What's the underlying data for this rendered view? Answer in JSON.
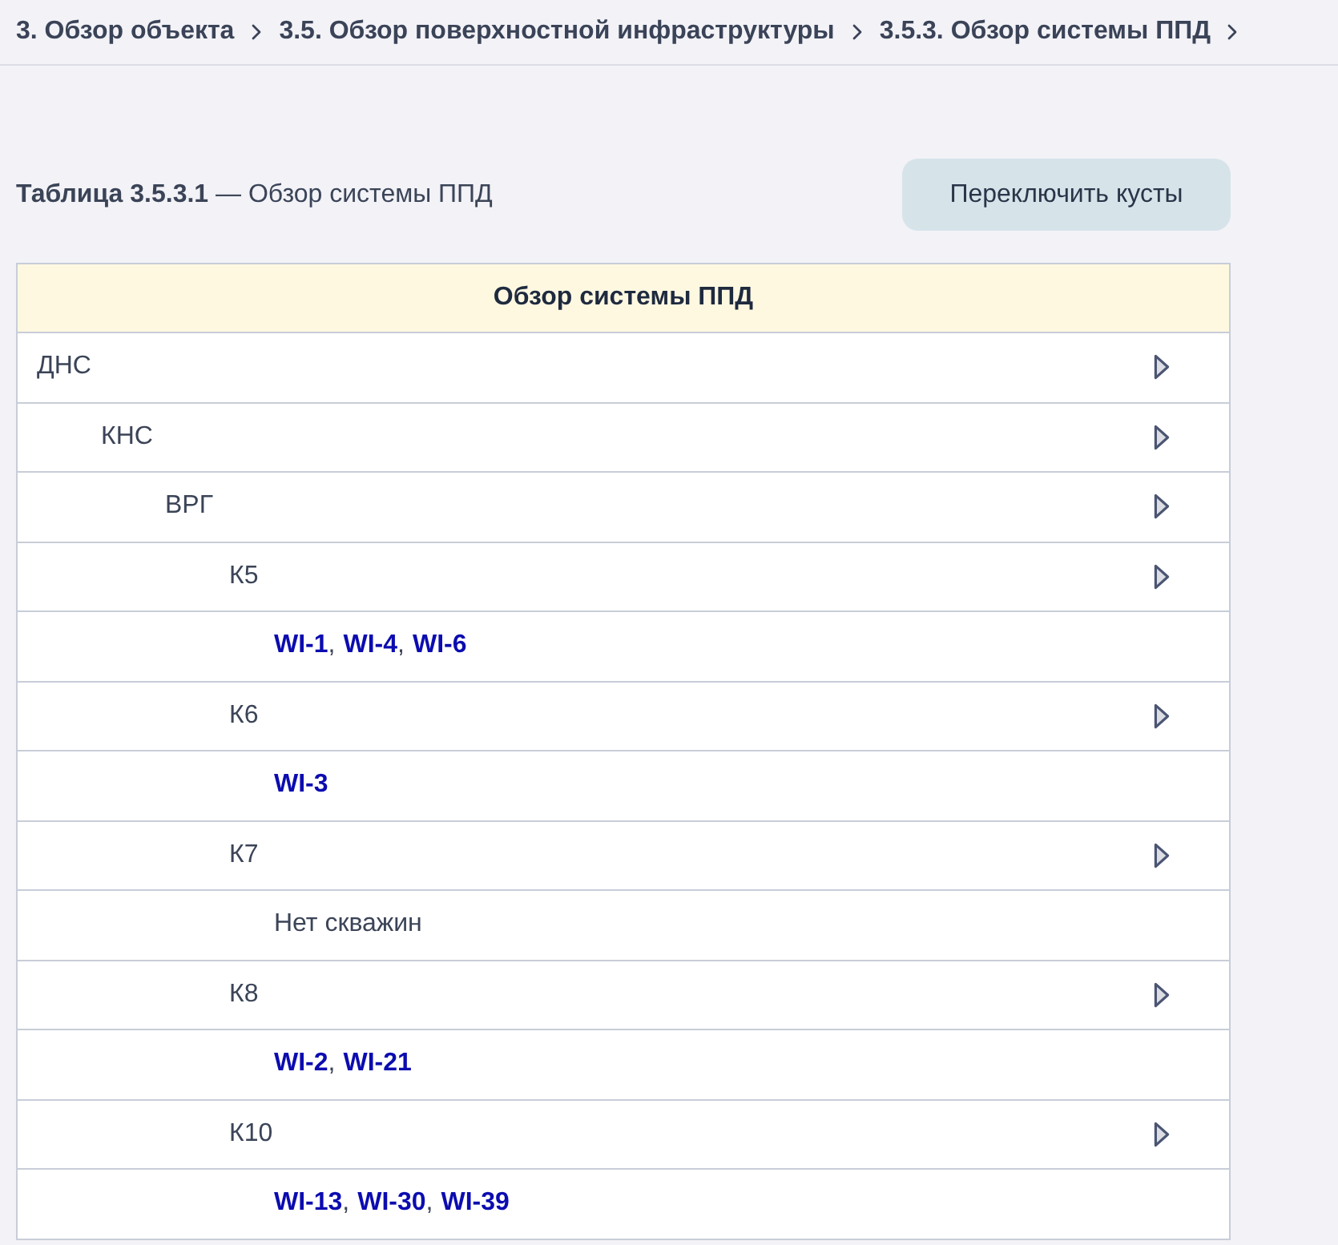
{
  "breadcrumbs": [
    "3. Обзор объекта",
    "3.5. Обзор поверхностной инфраструктуры",
    "3.5.3. Обзор системы ППД"
  ],
  "caption": "**Таблица 3.5.3.1** — Обзор системы ППД",
  "toggle_button": {
    "label": "Переключить кусты"
  },
  "table": {
    "header": "Обзор системы ППД",
    "list_separator": ",",
    "rows": [
      {
        "kind": "node",
        "label": "ДНС",
        "children": [
          {
            "kind": "node",
            "label": "КНС",
            "children": [
              {
                "kind": "node",
                "label": "ВРГ",
                "children": [
                  {
                    "kind": "node",
                    "label": "К5",
                    "children": [
                      {
                        "kind": "wells",
                        "wells": [
                          "WI-1",
                          "WI-4",
                          "WI-6"
                        ]
                      }
                    ]
                  },
                  {
                    "kind": "node",
                    "label": "К6",
                    "children": [
                      {
                        "kind": "wells",
                        "wells": [
                          "WI-3"
                        ]
                      }
                    ]
                  },
                  {
                    "kind": "node",
                    "label": "К7",
                    "children": [
                      {
                        "kind": "empty",
                        "label": "Нет скважин"
                      }
                    ]
                  },
                  {
                    "kind": "node",
                    "label": "К8",
                    "children": [
                      {
                        "kind": "wells",
                        "wells": [
                          "WI-2",
                          "WI-21"
                        ]
                      }
                    ]
                  },
                  {
                    "kind": "node",
                    "label": "К10",
                    "children": [
                      {
                        "kind": "wells",
                        "wells": [
                          "WI-13",
                          "WI-30",
                          "WI-39"
                        ]
                      }
                    ]
                  }
                ]
              }
            ]
          }
        ]
      }
    ]
  }
}
